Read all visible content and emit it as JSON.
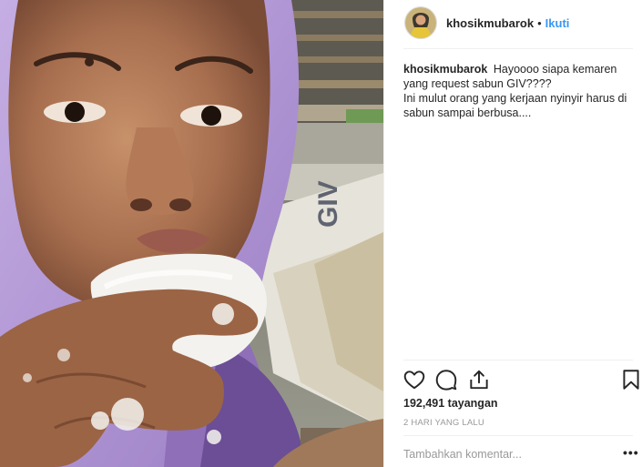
{
  "post": {
    "username": "khosikmubarok",
    "separator": "•",
    "follow_label": "Ikuti",
    "caption_lines": [
      "Hayoooo siapa kemaren yang request sabun GIV????",
      "Ini mulut orang yang kerjaan nyinyir harus di sabun sampai berbusa...."
    ],
    "views": "192,491 tayangan",
    "timestamp": "2 HARI YANG LALU",
    "comment_placeholder": "Tambahkan komentar...",
    "more_label": "•••"
  },
  "media": {
    "description_icon": "video-frame",
    "soap_box_brand": "GIV"
  },
  "icons": {
    "like": "heart-icon",
    "comment": "comment-bubble-icon",
    "share": "share-icon",
    "save": "bookmark-icon"
  },
  "colors": {
    "accent": "#3897f0",
    "text": "#262626",
    "muted": "#999999",
    "border": "#efefef",
    "hijab": "#b79bd6"
  }
}
